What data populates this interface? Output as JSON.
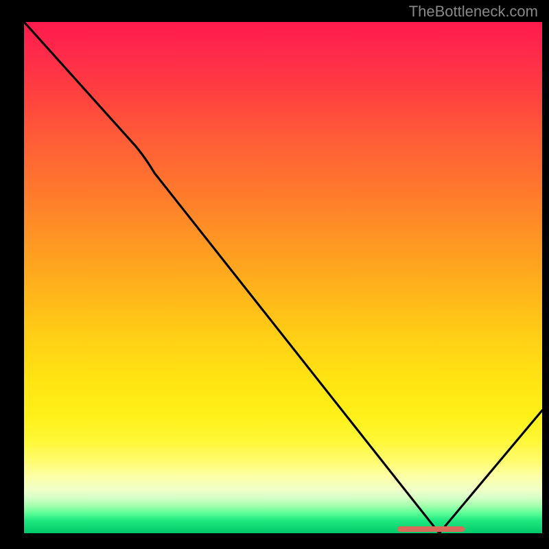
{
  "attribution": "TheBottleneck.com",
  "colors": {
    "background": "#000000",
    "attribution_text": "#888888",
    "curve": "#000000",
    "marker": "#d96a5a"
  },
  "chart_data": {
    "type": "line",
    "title": "",
    "xlabel": "",
    "ylabel": "",
    "xlim": [
      0,
      100
    ],
    "ylim": [
      0,
      100
    ],
    "background_gradient": {
      "top": "#ff1a4d",
      "middle": "#ffd015",
      "bottom": "#00c868"
    },
    "series": [
      {
        "name": "bottleneck-curve",
        "x": [
          0,
          25,
          80,
          100
        ],
        "values": [
          100,
          73,
          0,
          24
        ]
      }
    ],
    "marker_region": {
      "x_start": 72,
      "x_end": 85,
      "y": 0
    },
    "annotations": [],
    "legend": null
  }
}
